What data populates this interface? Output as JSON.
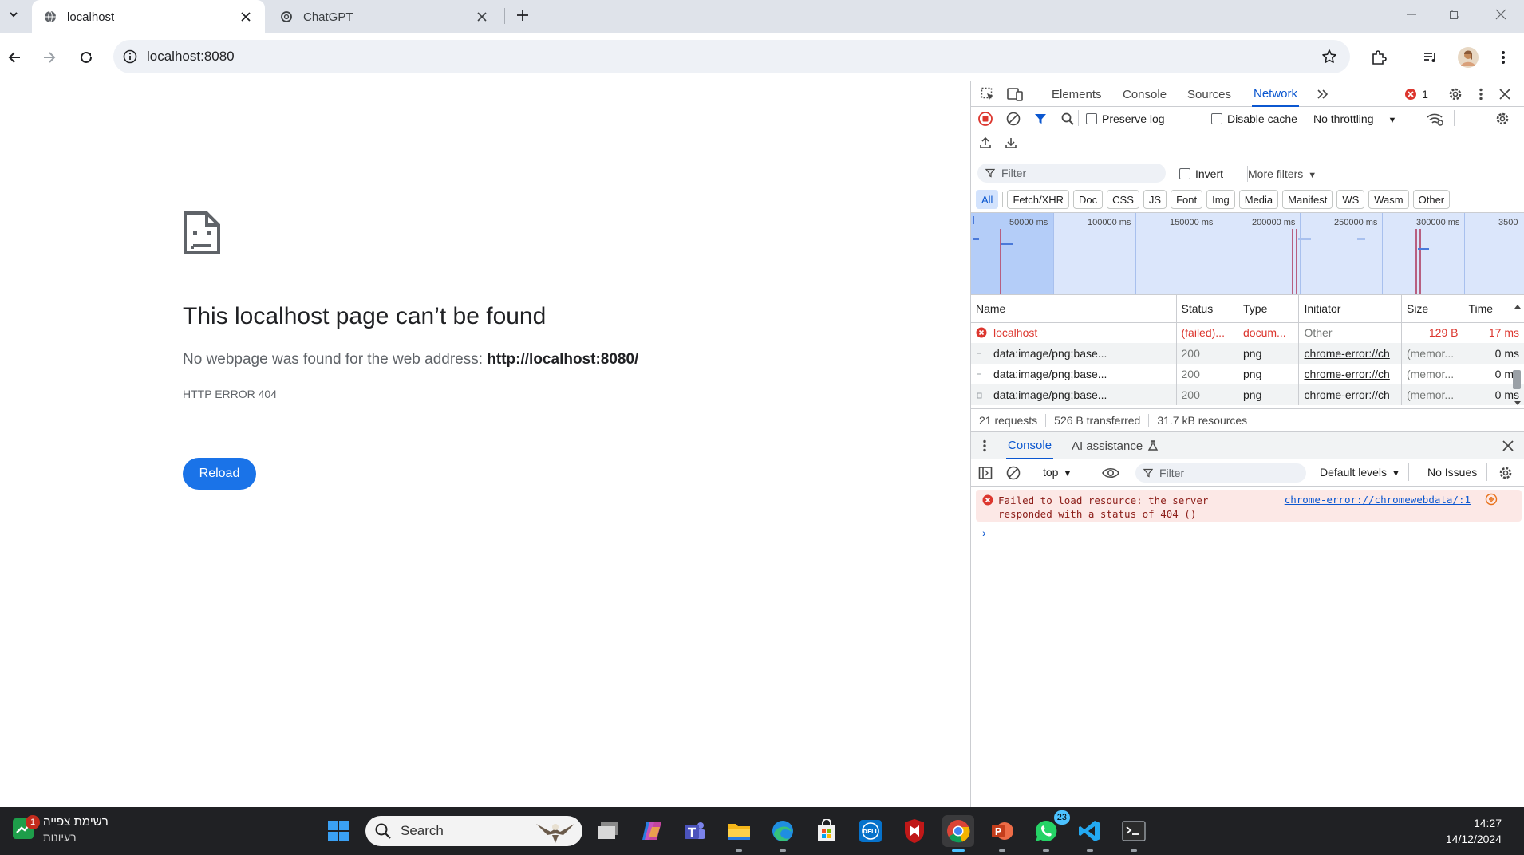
{
  "browser": {
    "tabs": [
      {
        "title": "localhost",
        "active": true
      },
      {
        "title": "ChatGPT",
        "active": false
      }
    ],
    "url": "localhost:8080"
  },
  "error_page": {
    "title": "This localhost page can’t be found",
    "description_prefix": "No webpage was found for the web address: ",
    "description_url": "http://localhost:8080/",
    "error_code": "HTTP ERROR 404",
    "reload_label": "Reload"
  },
  "devtools": {
    "tabs": [
      "Elements",
      "Console",
      "Sources",
      "Network"
    ],
    "active_tab": "Network",
    "error_count": "1",
    "toolbar": {
      "preserve_log": "Preserve log",
      "disable_cache": "Disable cache",
      "throttling": "No throttling"
    },
    "filter_placeholder": "Filter",
    "invert_label": "Invert",
    "more_filters": "More filters",
    "type_filters": [
      "All",
      "Fetch/XHR",
      "Doc",
      "CSS",
      "JS",
      "Font",
      "Img",
      "Media",
      "Manifest",
      "WS",
      "Wasm",
      "Other"
    ],
    "timeline_labels": [
      "50000 ms",
      "100000 ms",
      "150000 ms",
      "200000 ms",
      "250000 ms",
      "300000 ms",
      "3500"
    ],
    "columns": [
      "Name",
      "Status",
      "Type",
      "Initiator",
      "Size",
      "Time"
    ],
    "rows": [
      {
        "name": "localhost",
        "status": "(failed)...",
        "type": "docum...",
        "initiator": "Other",
        "size": "129 B",
        "time": "17 ms",
        "failed": true
      },
      {
        "name": "data:image/png;base...",
        "status": "200",
        "type": "png",
        "initiator": "chrome-error://ch",
        "size": "(memor...",
        "time": "0 ms",
        "failed": false
      },
      {
        "name": "data:image/png;base...",
        "status": "200",
        "type": "png",
        "initiator": "chrome-error://ch",
        "size": "(memor...",
        "time": "0 ms",
        "failed": false
      },
      {
        "name": "data:image/png;base...",
        "status": "200",
        "type": "png",
        "initiator": "chrome-error://ch",
        "size": "(memor...",
        "time": "0 ms",
        "failed": false
      }
    ],
    "summary": {
      "requests": "21 requests",
      "transferred": "526 B transferred",
      "resources": "31.7 kB resources"
    },
    "drawer": {
      "tabs": [
        "Console",
        "AI assistance"
      ],
      "context": "top",
      "filter_placeholder": "Filter",
      "levels": "Default levels",
      "issues": "No Issues",
      "error_line1": "Failed to load resource: the server",
      "error_line2": "responded with a status of 404 ()",
      "error_source": "chrome-error://chromewebdata/:1"
    }
  },
  "taskbar": {
    "widget_title": "רשימת צפייה",
    "widget_sub": "רעיונות",
    "widget_badge": "1",
    "search_placeholder": "Search",
    "whatsapp_badge": "23",
    "time": "14:27",
    "date": "14/12/2024",
    "apps": [
      "windows-start",
      "task-view",
      "copilot",
      "teams",
      "file-explorer",
      "edge",
      "microsoft-store",
      "dell",
      "mcafee",
      "chrome",
      "powerpoint",
      "whatsapp",
      "vscode",
      "terminal"
    ]
  },
  "colors": {
    "accent": "#1a73e8",
    "devtools_accent": "#0b57d0",
    "error": "#dc362e",
    "taskbar": "#202124"
  }
}
